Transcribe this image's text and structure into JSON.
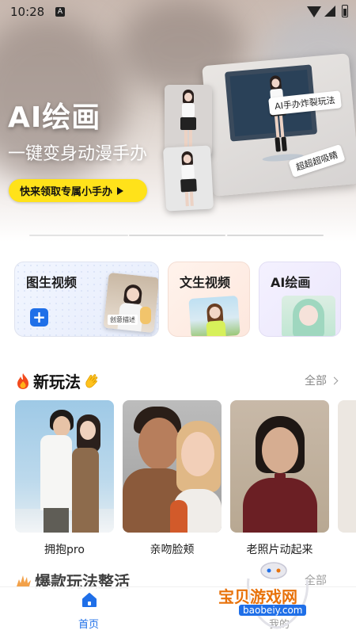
{
  "status_bar": {
    "time": "10:28",
    "notification_icon": "A"
  },
  "hero": {
    "title": "AI绘画",
    "subtitle": "一键变身动漫手办",
    "cta_label": "快来领取专属小手办",
    "chip_1": "AI手办炸裂玩法",
    "chip_2": "超超超吸睛"
  },
  "features": [
    {
      "label": "图生视频",
      "tag": "创意描述"
    },
    {
      "label": "文生视频"
    },
    {
      "label": "AI绘画"
    }
  ],
  "section_new": {
    "title": "新玩法",
    "all_label": "全部",
    "items": [
      {
        "caption": "拥抱pro"
      },
      {
        "caption": "亲吻脸颊"
      },
      {
        "caption": "老照片动起来"
      }
    ]
  },
  "section_hot": {
    "title": "爆款玩法整活",
    "all_label": "全部"
  },
  "nav": {
    "home_label": "首页",
    "mine_label": "我的"
  },
  "watermark": {
    "text": "宝贝游戏网",
    "url": "baobeiy.com"
  },
  "colors": {
    "accent": "#1f6fe8",
    "cta": "#ffe21a",
    "watermark": "#e8720b"
  }
}
